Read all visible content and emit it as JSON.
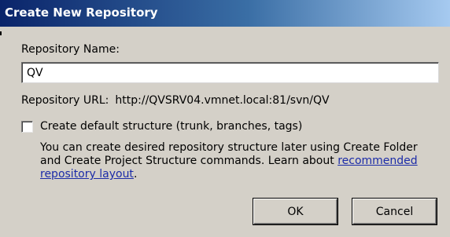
{
  "window": {
    "title": "Create New Repository"
  },
  "form": {
    "repository_name_label": "Repository Name:",
    "repository_name_value": "QV",
    "repository_url_label": "Repository URL:",
    "repository_url_value": "http://QVSRV04.vmnet.local:81/svn/QV",
    "default_structure_label": "Create default structure (trunk, branches, tags)",
    "default_structure_checked": false,
    "description_text": "You can create desired repository structure later using Create Folder and Create Project Structure commands. Learn about ",
    "description_link": "recommended repository layout",
    "description_end": "."
  },
  "buttons": {
    "ok_label": "OK",
    "cancel_label": "Cancel"
  },
  "colors": {
    "title_bar_start": "#0a246a",
    "title_bar_end": "#a6caf0",
    "dialog_background": "#d4d0c8",
    "link": "#1b2ba8"
  }
}
